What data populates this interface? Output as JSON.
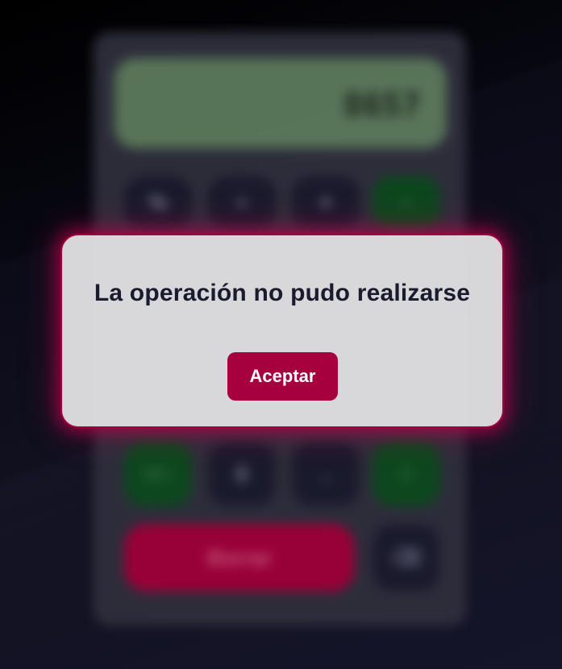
{
  "calculator": {
    "display_value": "8657",
    "keys_row1": [
      "%",
      "÷",
      "×",
      "−"
    ],
    "row5": [
      "+/−",
      "0",
      ".",
      "="
    ],
    "clear_label": "Borrar",
    "backspace_label": "⌫"
  },
  "dialog": {
    "message": "La operación no pudo realizarse",
    "accept_label": "Aceptar"
  },
  "colors": {
    "accent": "#a7003f",
    "modal_bg": "#dededf",
    "text_dark": "#1b1b2f"
  }
}
